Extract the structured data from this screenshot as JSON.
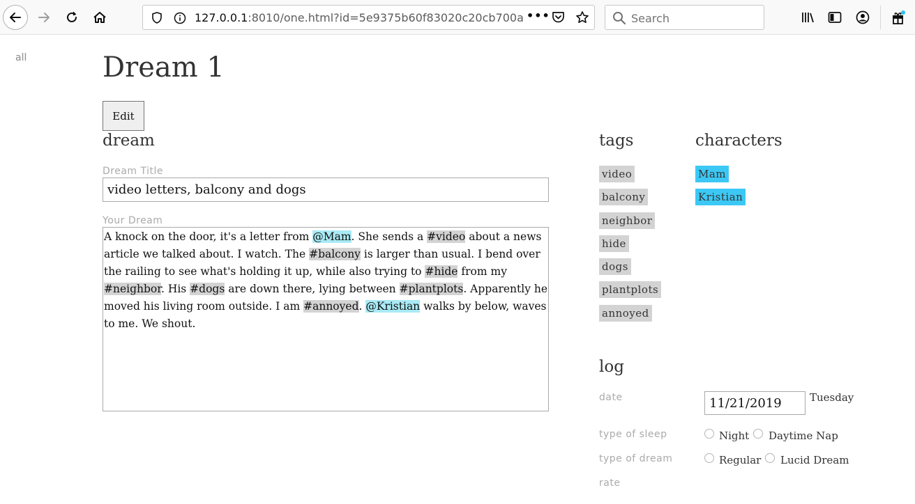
{
  "browser": {
    "url_host": "127.0.0.1",
    "url_rest": ":8010/one.html?id=5e9375b60f83020c20cb700a",
    "more_label": "•••",
    "search_placeholder": "Search"
  },
  "nav": {
    "all_link": "all"
  },
  "page": {
    "title": "Dream 1",
    "edit_label": "Edit"
  },
  "dream_section": {
    "heading": "dream",
    "title_label": "Dream Title",
    "title_value": "video letters, balcony and dogs",
    "body_label": "Your Dream",
    "body_segments": [
      {
        "text": "A knock on the door, it's a letter from ",
        "kind": "plain"
      },
      {
        "text": "@Mam",
        "kind": "character"
      },
      {
        "text": ". She sends a ",
        "kind": "plain"
      },
      {
        "text": "#video",
        "kind": "tag"
      },
      {
        "text": " about a news article we talked about. I watch. The ",
        "kind": "plain"
      },
      {
        "text": "#balcony",
        "kind": "tag"
      },
      {
        "text": " is larger than usual. I bend over the railing to see what's holding it up, while also trying to ",
        "kind": "plain"
      },
      {
        "text": "#hide",
        "kind": "tag"
      },
      {
        "text": " from my ",
        "kind": "plain"
      },
      {
        "text": "#neighbor",
        "kind": "tag"
      },
      {
        "text": ". His ",
        "kind": "plain"
      },
      {
        "text": "#dogs",
        "kind": "tag"
      },
      {
        "text": " are down there, lying between ",
        "kind": "plain"
      },
      {
        "text": "#plantplots",
        "kind": "tag"
      },
      {
        "text": ". Apparently he moved his living room outside. I am ",
        "kind": "plain"
      },
      {
        "text": "#annoyed",
        "kind": "tag"
      },
      {
        "text": ". ",
        "kind": "plain"
      },
      {
        "text": "@Kristian",
        "kind": "character"
      },
      {
        "text": " walks by below, waves to me. We shout.",
        "kind": "plain"
      }
    ]
  },
  "tags_section": {
    "heading": "tags",
    "items": [
      "video",
      "balcony",
      "neighbor",
      "hide",
      "dogs",
      "plantplots",
      "annoyed"
    ]
  },
  "characters_section": {
    "heading": "characters",
    "items": [
      "Mam",
      "Kristian"
    ]
  },
  "log_section": {
    "heading": "log",
    "date_label": "date",
    "date_value": "11/21/2019",
    "weekday": "Tuesday",
    "sleep_label": "type of sleep",
    "sleep_options": [
      "Night",
      "Daytime Nap"
    ],
    "dream_type_label": "type of dream",
    "dream_type_options": [
      "Regular",
      "Lucid Dream"
    ],
    "rate_label": "rate"
  },
  "colors": {
    "tag_highlight": "#d3d3d3",
    "character_highlight_inline": "#a9eaf5",
    "character_pill": "#3cc8f5"
  }
}
